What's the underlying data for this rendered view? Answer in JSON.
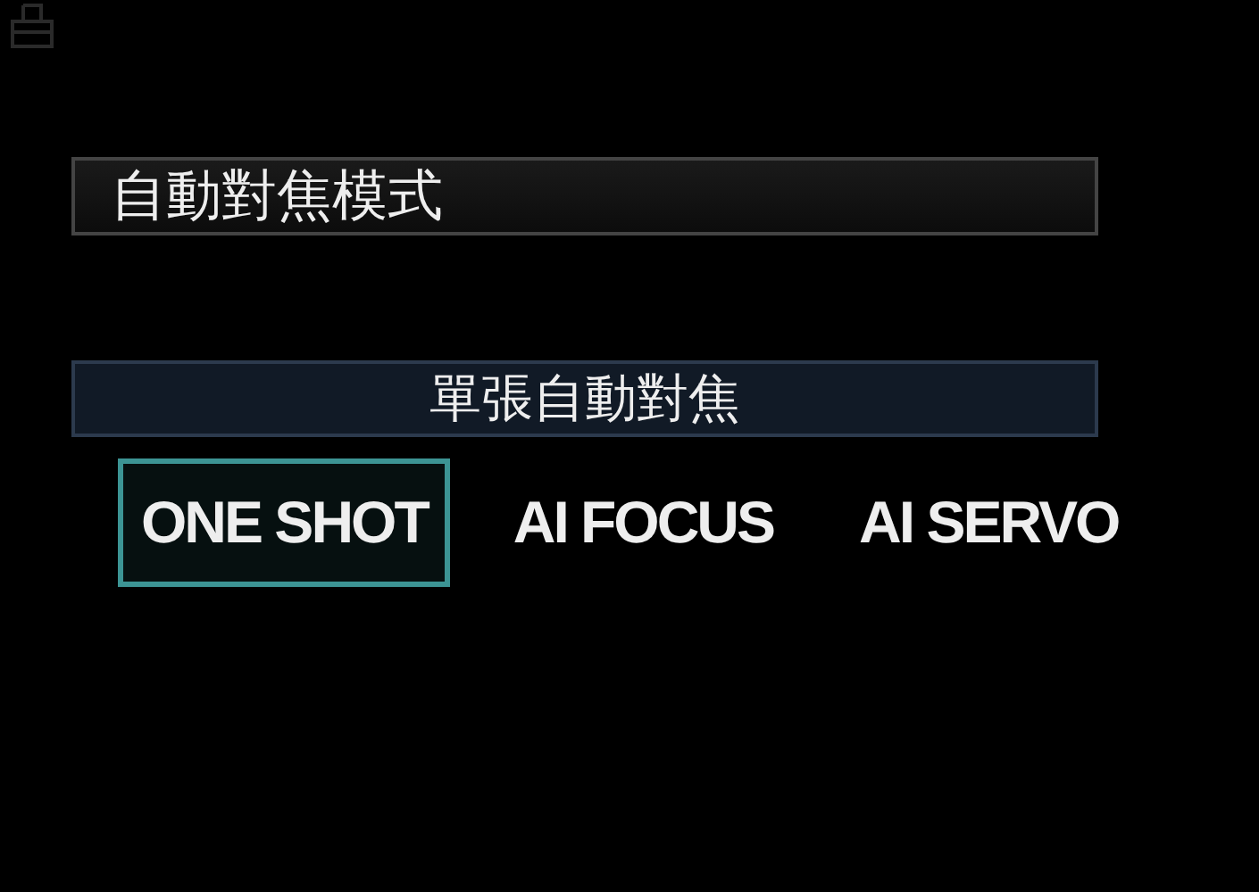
{
  "menu_title": "自動對焦模式",
  "selection_description": "單張自動對焦",
  "options": [
    {
      "label": "ONE SHOT",
      "selected": true
    },
    {
      "label": "AI FOCUS",
      "selected": false
    },
    {
      "label": "AI SERVO",
      "selected": false
    }
  ]
}
